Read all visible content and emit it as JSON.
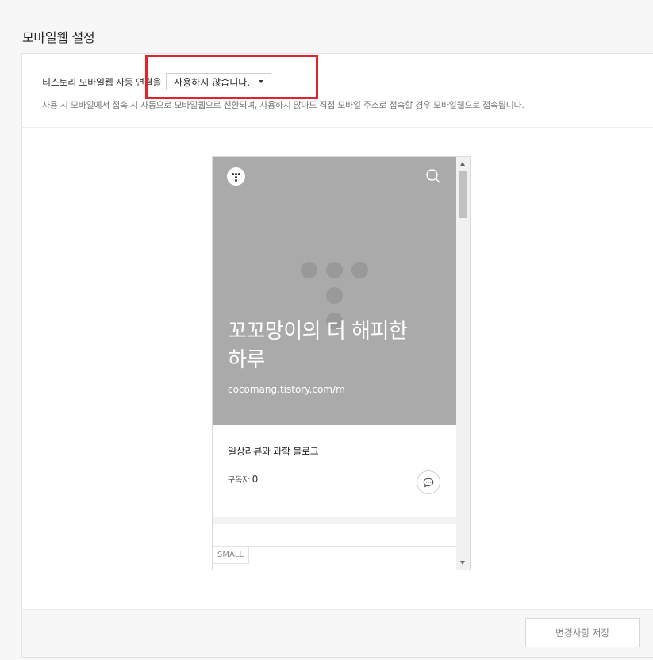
{
  "page": {
    "title": "모바일웹 설정"
  },
  "setting": {
    "label": "티스토리 모바일웹 자동 연결을",
    "select_value": "사용하지 않습니다.",
    "description": "사용 시 모바일에서 접속 시 자동으로 모바일웹으로 전환되며, 사용하지 않아도 직접 모바일 주소로 접속할 경우 모바일웹으로 접속됩니다."
  },
  "preview": {
    "blog_title": "꼬꼬망이의 더 해피한 하루",
    "blog_url": "cocomang.tistory.com/m",
    "blog_description": "일상리뷰와 과학 블로그",
    "subscriber_label": "구독자",
    "subscriber_count": "0",
    "size_tag": "SMALL"
  },
  "footer": {
    "save_label": "변경사항 저장"
  },
  "colors": {
    "hero_background": "#aaaaaa",
    "highlight": "#e3232c"
  },
  "icons": {
    "logo": "tistory-logo-icon",
    "search": "search-icon",
    "comment": "speech-bubble-icon",
    "dropdown": "caret-down-icon"
  }
}
